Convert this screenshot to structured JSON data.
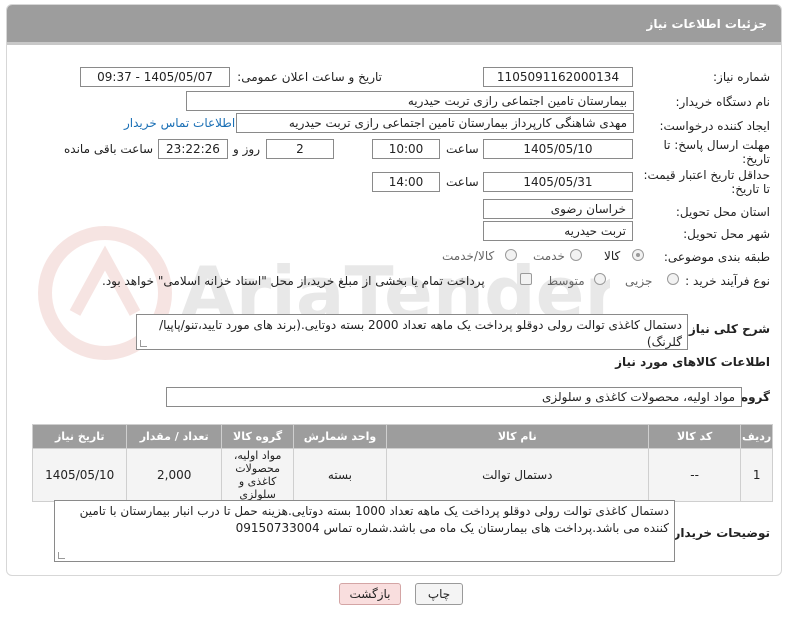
{
  "header": {
    "title": "جزئیات اطلاعات نیاز"
  },
  "fields": {
    "need_number_label": "شماره نیاز:",
    "need_number": "1105091162000134",
    "announce_label": "تاریخ و ساعت اعلان عمومی:",
    "announce_value": "1405/05/07 - 09:37",
    "buyer_org_label": "نام دستگاه خریدار:",
    "buyer_org": "بیمارستان تامین اجتماعی رازی تربت حیدریه",
    "requester_label": "ایجاد کننده درخواست:",
    "requester": "مهدی شاهنگی کارپرداز بیمارستان تامین اجتماعی رازی تربت حیدریه",
    "buyer_contact_link": "اطلاعات تماس خریدار",
    "deadline_label_1": "مهلت ارسال پاسخ: تا",
    "deadline_label_2": "تاریخ:",
    "deadline_date": "1405/05/10",
    "time_word": "ساعت",
    "deadline_time": "10:00",
    "days_value": "2",
    "days_word": "روز و",
    "remaining_time": "23:22:26",
    "remaining_word": "ساعت باقی مانده",
    "validity_label_1": "حداقل تاریخ اعتبار قیمت:",
    "validity_label_2": "تا تاریخ:",
    "validity_date": "1405/05/31",
    "validity_time": "14:00",
    "delivery_province_label": "استان محل تحویل:",
    "delivery_province": "خراسان رضوی",
    "delivery_city_label": "شهر محل تحویل:",
    "delivery_city": "تربت حیدریه",
    "category_label": "طبقه بندی موضوعی:",
    "category_options": [
      "کالا",
      "خدمت",
      "کالا/خدمت"
    ],
    "process_label": "نوع فرآیند خرید :",
    "process_options": [
      "جزیی",
      "متوسط"
    ],
    "payment_note": "پرداخت تمام یا بخشی از مبلغ خرید،از محل \"اسناد خزانه اسلامی\" خواهد بود."
  },
  "description": {
    "label": "شرح کلی نیاز:",
    "text": "دستمال کاغذی توالت رولی دوقلو پرداخت یک ماهه تعداد 2000 بسته دوتایی.(برند های مورد تایید،تنو/پاپیا/گلرنگ)"
  },
  "goods_info": {
    "title": "اطلاعات کالاهای مورد نیاز",
    "group_label": "گروه کالا:",
    "group_value": "مواد اولیه، محصولات کاغذی و سلولزی"
  },
  "table": {
    "headers": [
      "ردیف",
      "کد کالا",
      "نام کالا",
      "واحد شمارش",
      "گروه کالا",
      "تعداد / مقدار",
      "تاریخ نیاز"
    ],
    "rows": [
      [
        "1",
        "--",
        "دستمال توالت",
        "بسته",
        "مواد اولیه، محصولات کاغذی و سلولزی",
        "2,000",
        "1405/05/10"
      ]
    ]
  },
  "buyer_notes": {
    "label": "توضیحات خریدار:",
    "text": "دستمال کاغذی توالت رولی دوقلو پرداخت یک ماهه تعداد 1000 بسته دوتایی.هزینه حمل تا درب انبار بیمارستان با تامین کننده می باشد.پرداخت های بیمارستان یک ماه می باشد.شماره تماس 09150733004"
  },
  "buttons": {
    "print": "چاپ",
    "back": "بازگشت"
  },
  "watermark": "AriaTender.net",
  "colors": {
    "header_bg": "#9d9d9d",
    "link": "#1a6fb5",
    "back_btn_bg": "#f9dede"
  }
}
